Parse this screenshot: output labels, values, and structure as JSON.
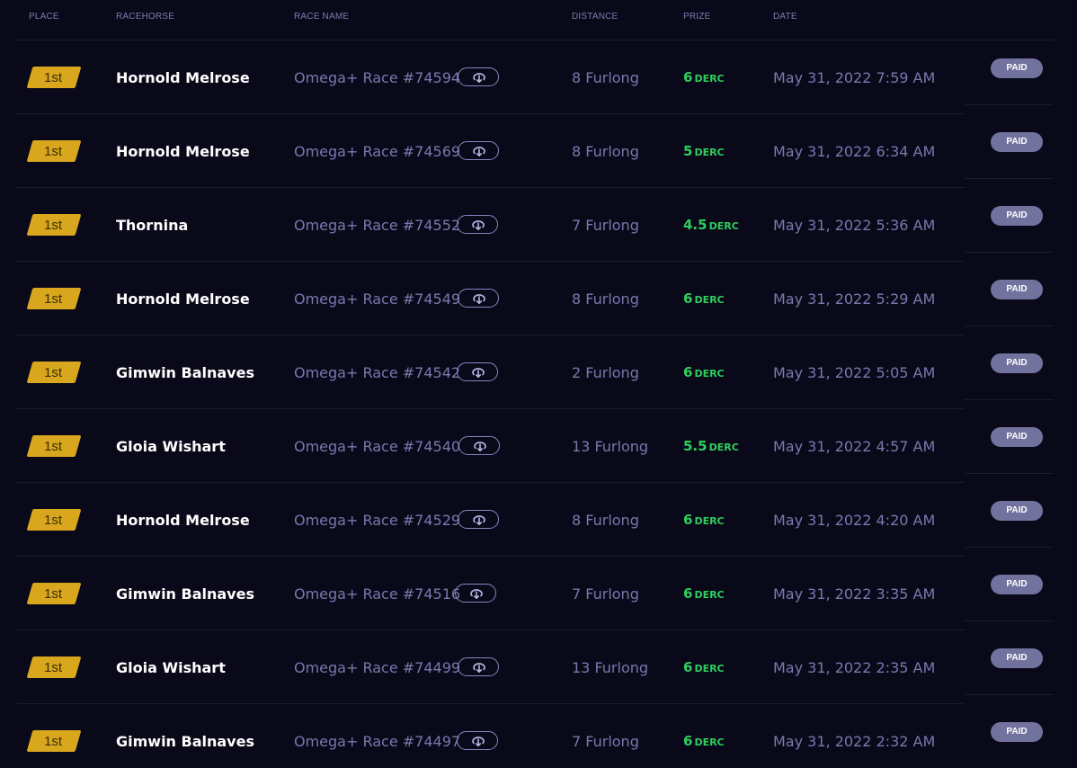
{
  "columns": {
    "place": "PLACE",
    "racehorse": "RACEHORSE",
    "race_name": "RACE NAME",
    "distance": "DISTANCE",
    "prize": "PRIZE",
    "date": "DATE"
  },
  "colors": {
    "background": "#09091a",
    "place_badge": "#d8a71e",
    "prize_green": "#2fcf5c",
    "muted_text": "#7a78ad",
    "paid_badge": "#72729e"
  },
  "icons": {
    "replay": "replay-icon"
  },
  "rows": [
    {
      "place": "1st",
      "horse": "Hornold Melrose",
      "race": "Omega+ Race #74594",
      "distance": "8 Furlong",
      "prize": "6",
      "currency": "DERC",
      "date": "May 31, 2022 7:59 AM",
      "status": "PAID"
    },
    {
      "place": "1st",
      "horse": "Hornold Melrose",
      "race": "Omega+ Race #74569",
      "distance": "8 Furlong",
      "prize": "5",
      "currency": "DERC",
      "date": "May 31, 2022 6:34 AM",
      "status": "PAID"
    },
    {
      "place": "1st",
      "horse": "Thornina",
      "race": "Omega+ Race #74552",
      "distance": "7 Furlong",
      "prize": "4.5",
      "currency": "DERC",
      "date": "May 31, 2022 5:36 AM",
      "status": "PAID"
    },
    {
      "place": "1st",
      "horse": "Hornold Melrose",
      "race": "Omega+ Race #74549",
      "distance": "8 Furlong",
      "prize": "6",
      "currency": "DERC",
      "date": "May 31, 2022 5:29 AM",
      "status": "PAID"
    },
    {
      "place": "1st",
      "horse": "Gimwin Balnaves",
      "race": "Omega+ Race #74542",
      "distance": "2 Furlong",
      "prize": "6",
      "currency": "DERC",
      "date": "May 31, 2022 5:05 AM",
      "status": "PAID"
    },
    {
      "place": "1st",
      "horse": "Gloia Wishart",
      "race": "Omega+ Race #74540",
      "distance": "13 Furlong",
      "prize": "5.5",
      "currency": "DERC",
      "date": "May 31, 2022 4:57 AM",
      "status": "PAID"
    },
    {
      "place": "1st",
      "horse": "Hornold Melrose",
      "race": "Omega+ Race #74529",
      "distance": "8 Furlong",
      "prize": "6",
      "currency": "DERC",
      "date": "May 31, 2022 4:20 AM",
      "status": "PAID"
    },
    {
      "place": "1st",
      "horse": "Gimwin Balnaves",
      "race": "Omega+ Race #74516",
      "distance": "7 Furlong",
      "prize": "6",
      "currency": "DERC",
      "date": "May 31, 2022 3:35 AM",
      "status": "PAID"
    },
    {
      "place": "1st",
      "horse": "Gloia Wishart",
      "race": "Omega+ Race #74499",
      "distance": "13 Furlong",
      "prize": "6",
      "currency": "DERC",
      "date": "May 31, 2022 2:35 AM",
      "status": "PAID"
    },
    {
      "place": "1st",
      "horse": "Gimwin Balnaves",
      "race": "Omega+ Race #74497",
      "distance": "7 Furlong",
      "prize": "6",
      "currency": "DERC",
      "date": "May 31, 2022 2:32 AM",
      "status": "PAID"
    }
  ]
}
